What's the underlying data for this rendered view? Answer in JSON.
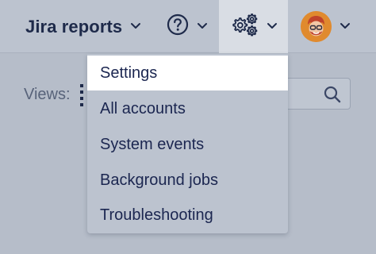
{
  "topbar": {
    "reports_label": "Jira reports"
  },
  "content": {
    "views_label": "Views:"
  },
  "menu": {
    "items": [
      {
        "label": "Settings",
        "selected": true
      },
      {
        "label": "All accounts"
      },
      {
        "label": "System events"
      },
      {
        "label": "Background jobs"
      },
      {
        "label": "Troubleshooting"
      }
    ]
  },
  "colors": {
    "text_dark": "#1e2a4a",
    "selected_bg": "#ffffff",
    "avatar_orange": "#e08a2e"
  }
}
